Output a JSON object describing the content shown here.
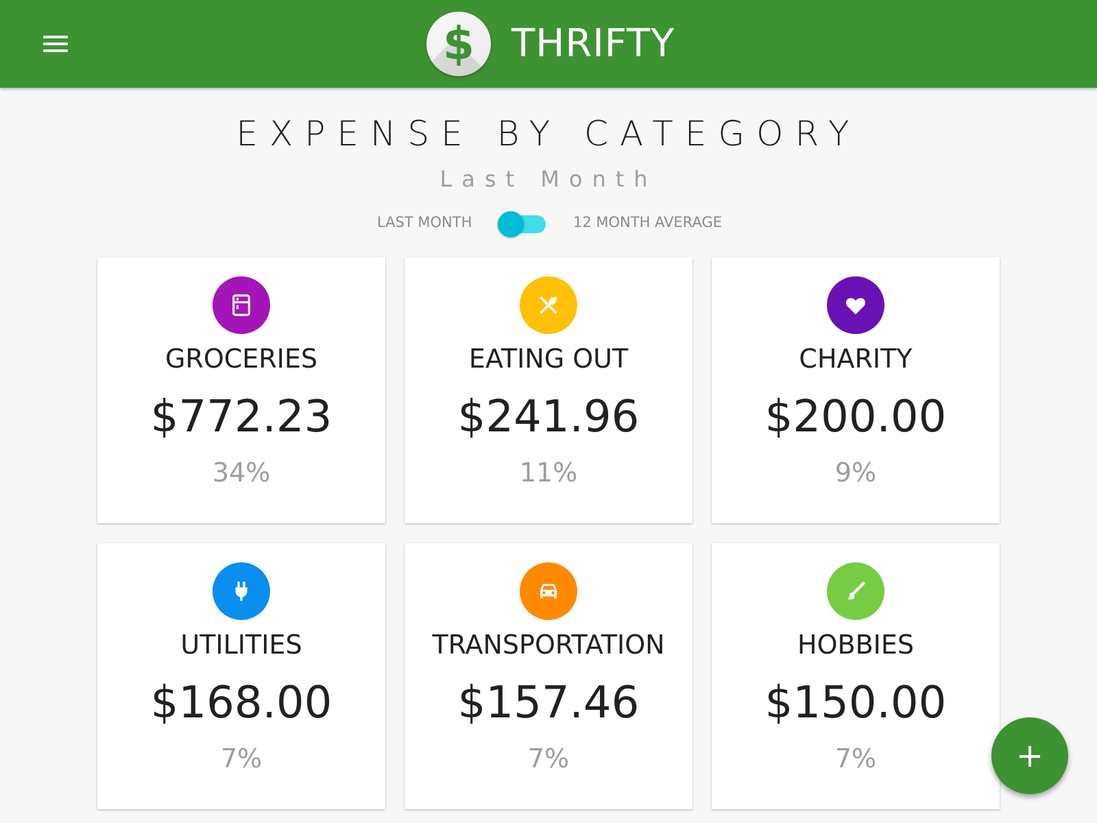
{
  "appbar": {
    "title": "THRIFTY",
    "logo_glyph": "$",
    "logo_icon": "dollar-icon",
    "menu_icon": "menu-icon",
    "color": "#3d9232"
  },
  "header": {
    "title": "EXPENSE BY CATEGORY",
    "subtitle": "Last Month"
  },
  "toggle": {
    "left_label": "LAST MONTH",
    "right_label": "12 MONTH AVERAGE",
    "state": "Last Month",
    "track_color": "#3fdcea",
    "thumb_color": "#00bcd4"
  },
  "categories": [
    {
      "name": "GROCERIES",
      "amount": "$772.23",
      "percent": "34%",
      "icon": "fridge-icon",
      "color": "#a414b8"
    },
    {
      "name": "EATING OUT",
      "amount": "$241.96",
      "percent": "11%",
      "icon": "utensils-icon",
      "color": "#ffc107"
    },
    {
      "name": "CHARITY",
      "amount": "$200.00",
      "percent": "9%",
      "icon": "heart-icon",
      "color": "#6a11b6"
    },
    {
      "name": "UTILITIES",
      "amount": "$168.00",
      "percent": "7%",
      "icon": "plug-icon",
      "color": "#0a8eef"
    },
    {
      "name": "TRANSPORTATION",
      "amount": "$157.46",
      "percent": "7%",
      "icon": "car-icon",
      "color": "#ff8a00"
    },
    {
      "name": "HOBBIES",
      "amount": "$150.00",
      "percent": "7%",
      "icon": "paintbrush-icon",
      "color": "#76cd43"
    }
  ],
  "fab": {
    "glyph": "+",
    "icon": "plus-icon",
    "color": "#3d9232"
  }
}
